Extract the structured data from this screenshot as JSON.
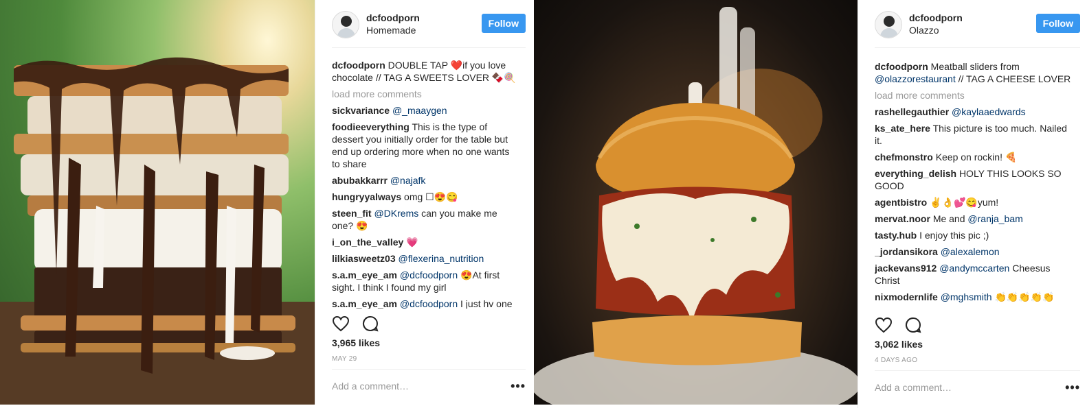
{
  "posts": [
    {
      "username": "dcfoodporn",
      "location": "Homemade",
      "follow_label": "Follow",
      "caption_user": "dcfoodporn",
      "caption_text": "DOUBLE TAP ❤️if you love chocolate // TAG A SWEETS LOVER 🍫🍭",
      "load_more": "load more comments",
      "comments": [
        {
          "user": "sickvariance",
          "mention": "@_maaygen",
          "text": ""
        },
        {
          "user": "foodieeverything",
          "mention": "",
          "text": "This is the type of dessert you initially order for the table but end up ordering more when no one wants to share"
        },
        {
          "user": "abubakkarrr",
          "mention": "@najafk",
          "text": ""
        },
        {
          "user": "hungryyalways",
          "mention": "",
          "text": "omg ☐😍😋"
        },
        {
          "user": "steen_fit",
          "mention": "@DKrems",
          "text": "can you make me one? 😍"
        },
        {
          "user": "i_on_the_valley",
          "mention": "",
          "text": "💗"
        },
        {
          "user": "lilkiasweetz03",
          "mention": "@flexerina_nutrition",
          "text": ""
        },
        {
          "user": "s.a.m_eye_am",
          "mention": "@dcfoodporn",
          "text": "😍At first sight. I think I found my girl"
        },
        {
          "user": "s.a.m_eye_am",
          "mention": "@dcfoodporn",
          "text": "I just hv one"
        }
      ],
      "likes": "3,965 likes",
      "date": "MAY 29",
      "comment_placeholder": "Add a comment…",
      "more_label": "•••",
      "icons": {
        "like": "heart-icon",
        "comment": "comment-bubble-icon"
      }
    },
    {
      "username": "dcfoodporn",
      "location": "Olazzo",
      "follow_label": "Follow",
      "caption_user": "dcfoodporn",
      "caption_text": "Meatball sliders from",
      "caption_mention": "@olazzorestaurant",
      "caption_text2": "// TAG A CHEESE LOVER",
      "load_more": "load more comments",
      "comments": [
        {
          "user": "rashellegauthier",
          "mention": "@kaylaaedwards",
          "text": ""
        },
        {
          "user": "ks_ate_here",
          "mention": "",
          "text": "This picture is too much. Nailed it."
        },
        {
          "user": "chefmonstro",
          "mention": "",
          "text": "Keep on rockin! 🍕"
        },
        {
          "user": "everything_delish",
          "mention": "",
          "text": "HOLY THIS LOOKS SO GOOD"
        },
        {
          "user": "agentbistro",
          "mention": "",
          "text": "✌️👌💕😋yum!"
        },
        {
          "user": "mervat.noor",
          "mention": "",
          "text": "Me and"
        },
        {
          "user": "tasty.hub",
          "mention": "",
          "text": "I enjoy this pic ;)"
        },
        {
          "user": "_jordansikora",
          "mention": "@alexalemon",
          "text": ""
        },
        {
          "user": "jackevans912",
          "mention": "@andymccarten",
          "text": "Cheesus Christ"
        },
        {
          "user": "nixmodernlife",
          "mention": "@mghsmith",
          "text": "👏👏👏👏👏"
        }
      ],
      "mervat_mention": "@ranja_bam",
      "likes": "3,062 likes",
      "date": "4 DAYS AGO",
      "comment_placeholder": "Add a comment…",
      "more_label": "•••",
      "icons": {
        "like": "heart-icon",
        "comment": "comment-bubble-icon"
      }
    }
  ],
  "colors": {
    "follow_blue": "#3897f0",
    "mention_blue": "#003569",
    "muted_gray": "#999999",
    "divider": "#efefef"
  }
}
